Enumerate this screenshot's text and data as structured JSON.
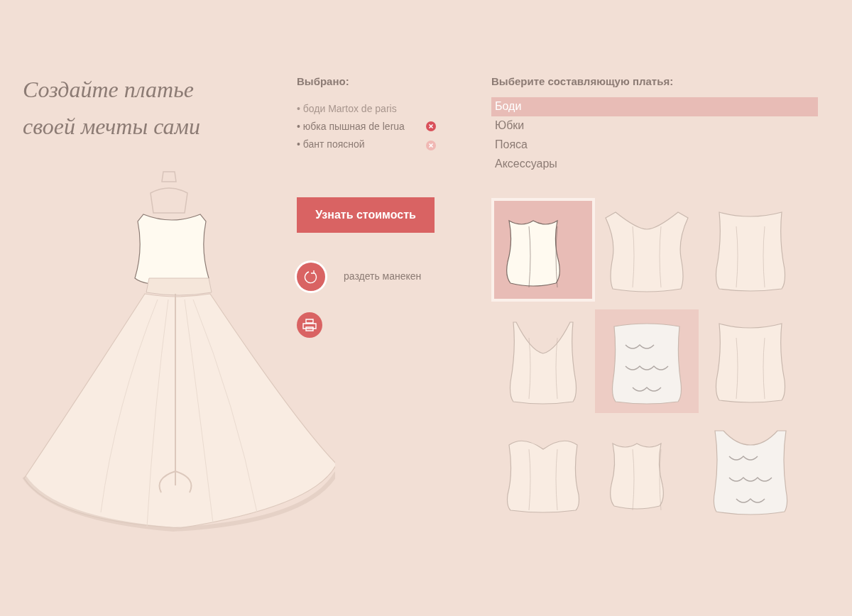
{
  "title": "Создайте платье своей мечты сами",
  "selected_panel": {
    "heading": "Выбрано:",
    "items": [
      {
        "label": "• боди Martox de paris",
        "removable": false
      },
      {
        "label": "• юбка пышная de lerua",
        "removable": true,
        "hovered": false
      },
      {
        "label": "• бант поясной",
        "removable": true,
        "hovered": true
      }
    ]
  },
  "price_button": "Узнать стоимость",
  "undress_button": {
    "label": "раздеть манекен",
    "hovered": true
  },
  "categories": {
    "heading": "Выберите составляющую платья:",
    "items": [
      {
        "label": "Боди",
        "selected": true
      },
      {
        "label": "Юбки",
        "selected": false
      },
      {
        "label": "Пояса",
        "selected": false
      },
      {
        "label": "Аксессуары",
        "selected": false
      }
    ]
  },
  "bodices": [
    {
      "kind": "strapless",
      "selected": true
    },
    {
      "kind": "offshoulder",
      "selected": false
    },
    {
      "kind": "boatneck",
      "selected": false
    },
    {
      "kind": "vneck",
      "selected": false
    },
    {
      "kind": "lace",
      "selected": false,
      "hovered": true
    },
    {
      "kind": "boatneck",
      "selected": false
    },
    {
      "kind": "sweetheart",
      "selected": false
    },
    {
      "kind": "strapless",
      "selected": false
    },
    {
      "kind": "lacestraps",
      "selected": false
    }
  ]
}
